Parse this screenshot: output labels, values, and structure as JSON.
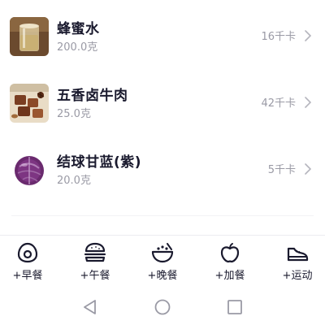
{
  "food_items": [
    {
      "name": "蜂蜜水",
      "amount": "200.0克",
      "calories": "16千卡",
      "thumb_icon": "honey-water-photo"
    },
    {
      "name": "五香卤牛肉",
      "amount": "25.0克",
      "calories": "42千卡",
      "thumb_icon": "braised-beef-photo"
    },
    {
      "name": "结球甘蓝(紫)",
      "amount": "20.0克",
      "calories": "5千卡",
      "thumb_icon": "purple-cabbage-photo"
    }
  ],
  "meal_bar": [
    {
      "label": "+早餐",
      "icon": "egg-icon"
    },
    {
      "label": "+午餐",
      "icon": "burger-icon"
    },
    {
      "label": "+晚餐",
      "icon": "bowl-icon"
    },
    {
      "label": "+加餐",
      "icon": "apple-icon"
    },
    {
      "label": "+运动",
      "icon": "sneaker-icon"
    }
  ],
  "system_nav": [
    {
      "icon": "back-triangle-icon"
    },
    {
      "icon": "home-circle-icon"
    },
    {
      "icon": "recents-square-icon"
    }
  ],
  "colors": {
    "text": "#1a1a2e",
    "muted": "#9a9aa5",
    "divider": "#ececf0",
    "system_nav": "#9a9aa5"
  }
}
